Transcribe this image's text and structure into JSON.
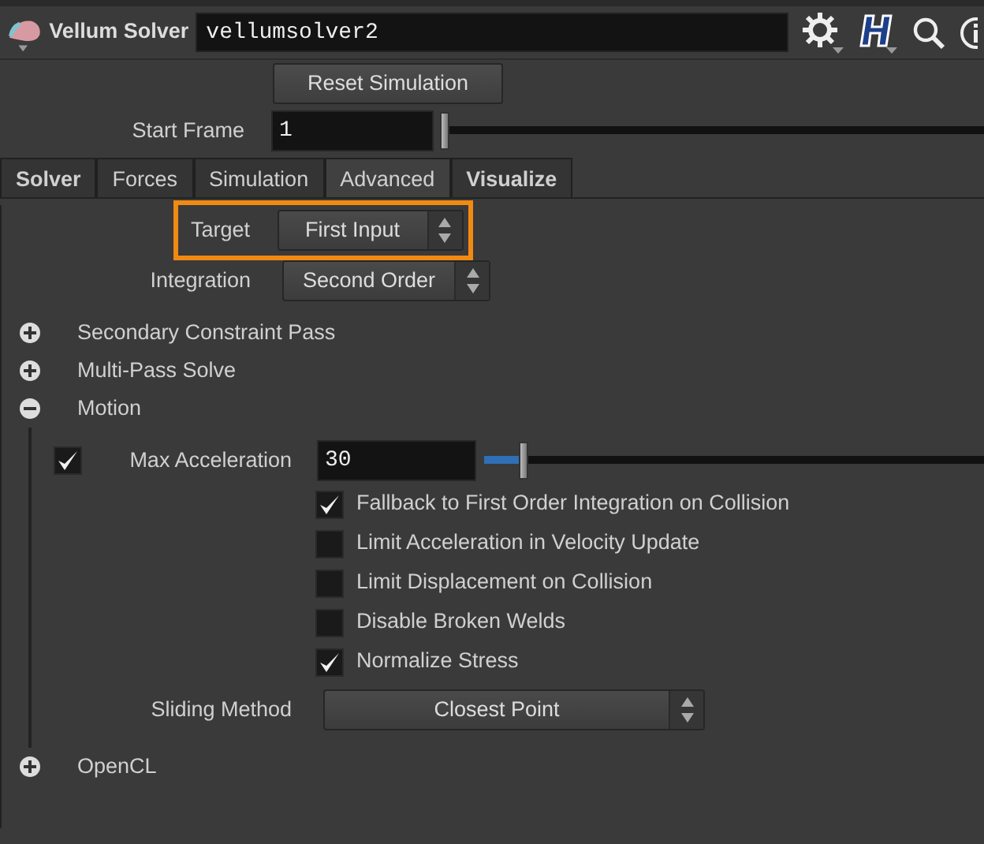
{
  "node": {
    "type_label": "Vellum Solver",
    "name": "vellumsolver2"
  },
  "reset_button": "Reset Simulation",
  "start_frame": {
    "label": "Start Frame",
    "value": "1",
    "level": 0
  },
  "tabs": [
    {
      "label": "Solver",
      "selected": false,
      "bold": true
    },
    {
      "label": "Forces",
      "selected": false,
      "bold": false
    },
    {
      "label": "Simulation",
      "selected": false,
      "bold": false
    },
    {
      "label": "Advanced",
      "selected": true,
      "bold": false
    },
    {
      "label": "Visualize",
      "selected": false,
      "bold": true
    }
  ],
  "params": [
    {
      "kind": "menu",
      "label": "Target",
      "value": "First Input",
      "highlighted": true
    },
    {
      "kind": "menu",
      "label": "Integration",
      "value": "Second Order",
      "highlighted": false
    }
  ],
  "folders": [
    {
      "label": "Secondary Constraint Pass",
      "expanded": false
    },
    {
      "label": "Multi-Pass Solve",
      "expanded": false
    },
    {
      "label": "Motion",
      "expanded": true,
      "children": [
        {
          "kind": "slider",
          "label": "Max Acceleration",
          "checked": true,
          "value": "30",
          "level": 0.07
        },
        {
          "kind": "toggle",
          "label": "Fallback to First Order Integration on Collision",
          "checked": true
        },
        {
          "kind": "toggle",
          "label": "Limit Acceleration in Velocity Update",
          "checked": false
        },
        {
          "kind": "toggle",
          "label": "Limit Displacement on Collision",
          "checked": false
        },
        {
          "kind": "toggle",
          "label": "Disable Broken Welds",
          "checked": false
        },
        {
          "kind": "toggle",
          "label": "Normalize Stress",
          "checked": true
        },
        {
          "kind": "menu",
          "label": "Sliding Method",
          "value": "Closest Point"
        }
      ]
    },
    {
      "label": "OpenCL",
      "expanded": false
    }
  ]
}
